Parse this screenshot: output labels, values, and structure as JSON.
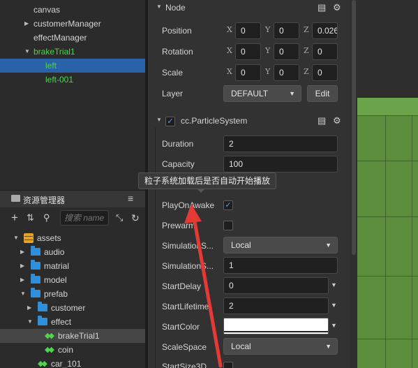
{
  "hierarchy": {
    "items": [
      {
        "label": "canvas",
        "indent": 1,
        "expandable": false,
        "expanded": false,
        "color": "normal",
        "selected": false
      },
      {
        "label": "customerManager",
        "indent": 1,
        "expandable": true,
        "expanded": false,
        "color": "normal",
        "selected": false
      },
      {
        "label": "effectManager",
        "indent": 1,
        "expandable": false,
        "expanded": false,
        "color": "normal",
        "selected": false
      },
      {
        "label": "brakeTrial1",
        "indent": 1,
        "expandable": true,
        "expanded": true,
        "color": "green",
        "selected": false
      },
      {
        "label": "left",
        "indent": 2,
        "expandable": false,
        "expanded": false,
        "color": "green",
        "selected": true
      },
      {
        "label": "left-001",
        "indent": 2,
        "expandable": false,
        "expanded": false,
        "color": "green",
        "selected": false
      }
    ]
  },
  "assets": {
    "title": "资源管理器",
    "search_placeholder": "搜索 name",
    "icons": [
      "folder-panel-icon",
      "menu-icon",
      "add-icon",
      "sort-icon",
      "search-dropdown-icon",
      "collapse-icon",
      "refresh-icon"
    ],
    "tree": [
      {
        "label": "assets",
        "indent": 0,
        "icon": "database",
        "expandable": true,
        "expanded": true,
        "selected": false
      },
      {
        "label": "audio",
        "indent": 1,
        "icon": "folder",
        "expandable": true,
        "expanded": false,
        "selected": false
      },
      {
        "label": "matrial",
        "indent": 1,
        "icon": "folder",
        "expandable": true,
        "expanded": false,
        "selected": false
      },
      {
        "label": "model",
        "indent": 1,
        "icon": "folder",
        "expandable": true,
        "expanded": false,
        "selected": false
      },
      {
        "label": "prefab",
        "indent": 1,
        "icon": "folder",
        "expandable": true,
        "expanded": true,
        "selected": false
      },
      {
        "label": "customer",
        "indent": 2,
        "icon": "folder",
        "expandable": true,
        "expanded": false,
        "selected": false
      },
      {
        "label": "effect",
        "indent": 2,
        "icon": "folder",
        "expandable": true,
        "expanded": true,
        "selected": false
      },
      {
        "label": "brakeTrial1",
        "indent": 3,
        "icon": "prefab",
        "expandable": false,
        "expanded": false,
        "selected": true
      },
      {
        "label": "coin",
        "indent": 3,
        "icon": "prefab",
        "expandable": false,
        "expanded": false,
        "selected": false
      },
      {
        "label": "car_101",
        "indent": 2,
        "icon": "prefab",
        "expandable": false,
        "expanded": false,
        "selected": false
      }
    ]
  },
  "inspector": {
    "node": {
      "title": "Node",
      "position": {
        "label": "Position",
        "x": "0",
        "y": "0",
        "z": "0.026"
      },
      "rotation": {
        "label": "Rotation",
        "x": "0",
        "y": "0",
        "z": "0"
      },
      "scale": {
        "label": "Scale",
        "x": "0",
        "y": "0",
        "z": "0"
      },
      "layer": {
        "label": "Layer",
        "value": "DEFAULT",
        "edit_label": "Edit"
      }
    },
    "axis_labels": {
      "x": "X",
      "y": "Y",
      "z": "Z"
    },
    "particle": {
      "title": "cc.ParticleSystem",
      "enabled": true,
      "duration": {
        "label": "Duration",
        "value": "2"
      },
      "capacity": {
        "label": "Capacity",
        "value": "100"
      },
      "play_on_awake": {
        "label": "PlayOnAwake",
        "checked": true
      },
      "prewarm": {
        "label": "Prewarm",
        "checked": false
      },
      "simulation_space": {
        "label": "SimulationS...",
        "value": "Local"
      },
      "simulation_speed": {
        "label": "SimulationS...",
        "value": "1"
      },
      "start_delay": {
        "label": "StartDelay",
        "value": "0"
      },
      "start_lifetime": {
        "label": "StartLifetime",
        "value": "2"
      },
      "start_color": {
        "label": "StartColor",
        "value": "#ffffff"
      },
      "scale_space": {
        "label": "ScaleSpace",
        "value": "Local"
      },
      "start_size_3d": {
        "label": "StartSize3D",
        "checked": false
      }
    },
    "tooltip": "粒子系统加载后是否自动开始播放"
  },
  "colors": {
    "selection": "#2962a8",
    "green_text": "#4fd44f",
    "folder": "#2f8fdb",
    "scene_green": "#5b8d3d",
    "annotation_arrow": "#e53935"
  }
}
